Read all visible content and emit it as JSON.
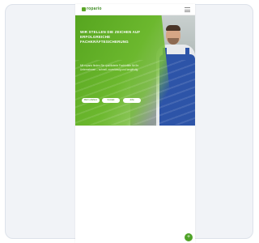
{
  "brand": {
    "logo_text": "ropario"
  },
  "hero": {
    "title": "Wir stellen die Zeichen auf erfolgreiche Fachkräftesicherung",
    "text": "Mit ropario finden Sie qualifizierte Fachkräfte für Ihr Unternehmen – schnell, zuverlässig und langfristig.",
    "buttons": [
      "Mehr erfahren",
      "Kontakt",
      "Jobs"
    ]
  },
  "colors": {
    "accent": "#5aa626",
    "overall": "#2d54a8"
  },
  "icons": {
    "menu": "hamburger-menu-icon",
    "fab": "chat-icon"
  }
}
